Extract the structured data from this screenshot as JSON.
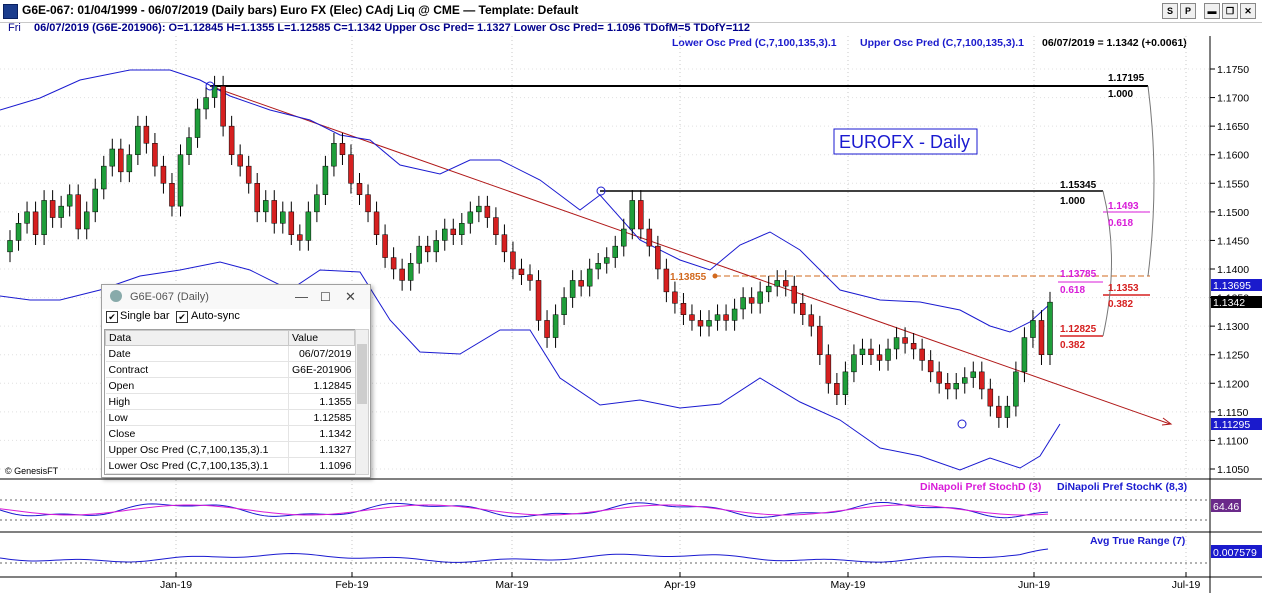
{
  "window": {
    "title": "G6E-067:  01/04/1999 - 06/07/2019  (Daily bars)   Euro FX (Elec) CAdj Liq @ CME  —  Template: Default",
    "buttons": [
      "S",
      "P",
      "▬",
      "❐",
      "✕"
    ]
  },
  "infobar": {
    "day": "Fri",
    "ohlc": "06/07/2019 (G6E-201906):  O=1.12845  H=1.1355  L=1.12585  C=1.1342  Upper Osc Pred= 1.1327  Lower Osc Pred= 1.1096  TDofM=5  TDofY=112",
    "legend_lower": "Lower Osc Pred (C,7,100,135,3).1",
    "legend_upper": "Upper Osc Pred (C,7,100,135,3).1",
    "last": "06/07/2019 = 1.1342 (+0.0061)"
  },
  "annotations": {
    "chart_label": "EUROFX - Daily",
    "level_high": "1.17195",
    "level_high_ratio": "1.000",
    "level_mid": "1.15345",
    "level_mid_ratio": "1.000",
    "level_1493": "1.1493",
    "level_1493_ratio": "0.618",
    "level_13785": "1.13785",
    "level_13785_ratio": "0.618",
    "level_1353": "1.1353",
    "level_1353_ratio": "0.382",
    "level_12825": "1.12825",
    "level_12825_ratio": "0.382",
    "level_13855": "1.13855",
    "copyright": "© GenesisFT"
  },
  "price_axis": {
    "ticks": [
      "1.1750",
      "1.1700",
      "1.1650",
      "1.1600",
      "1.1550",
      "1.1500",
      "1.1450",
      "1.1400",
      "1.1350",
      "1.1300",
      "1.1250",
      "1.1200",
      "1.1150",
      "1.1100",
      "1.1050"
    ],
    "badge_upper": "1.13695",
    "badge_close": "1.1342",
    "badge_lower": "1.11295"
  },
  "date_axis": [
    "Jan-19",
    "Feb-19",
    "Mar-19",
    "Apr-19",
    "May-19",
    "Jun-19",
    "Jul-19"
  ],
  "indicators": {
    "stoch_d": "DiNapoli Pref StochD (3)",
    "stoch_k": "DiNapoli Pref StochK (8,3)",
    "stoch_value": "64.46",
    "atr": "Avg True Range (7)",
    "atr_value": "0.007579"
  },
  "dialog": {
    "title": "G6E-067 (Daily)",
    "single_bar": "Single bar",
    "auto_sync": "Auto-sync",
    "col_data": "Data",
    "col_value": "Value",
    "rows": [
      {
        "k": "Date",
        "v": "06/07/2019"
      },
      {
        "k": "Contract",
        "v": "G6E-201906"
      },
      {
        "k": "Open",
        "v": "1.12845"
      },
      {
        "k": "High",
        "v": "1.1355"
      },
      {
        "k": "Low",
        "v": "1.12585"
      },
      {
        "k": "Close",
        "v": "1.1342"
      },
      {
        "k": "Upper Osc Pred (C,7,100,135,3).1",
        "v": "1.1327"
      },
      {
        "k": "Lower Osc Pred (C,7,100,135,3).1",
        "v": "1.1096"
      }
    ]
  },
  "colors": {
    "up": "#1f9e3a",
    "down": "#d62020",
    "band": "#1a1ad0",
    "trend": "#b01818",
    "magenta": "#d81bd8",
    "orange": "#d2691e",
    "label": "#00008b"
  }
}
